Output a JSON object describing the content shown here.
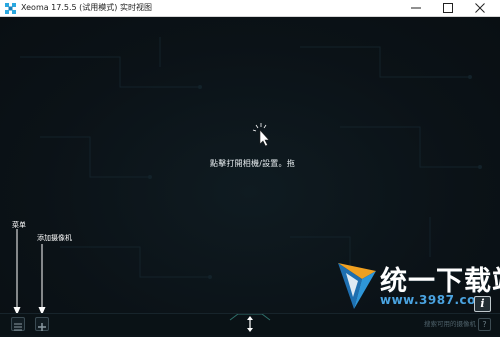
{
  "window": {
    "title": "Xeoma 17.5.5 (试用模式) 实时视图",
    "minimize_icon": "minimize-icon",
    "maximize_icon": "maximize-icon",
    "close_icon": "close-icon"
  },
  "main": {
    "hint": "點擊打開相機/設置。拖",
    "cursor_icon": "click-cursor-icon"
  },
  "annotations": {
    "menu_label": "菜单",
    "add_camera_label": "添加摄像机"
  },
  "bottom_bar": {
    "menu_icon": "list-menu-icon",
    "add_icon": "plus-icon",
    "resize_icon": "vertical-resize-icon",
    "search_placeholder": "搜索可用的摄像机",
    "help_label": "?",
    "info_label": "i"
  },
  "watermark": {
    "title": "统一下载站",
    "url": "www.3987.com"
  },
  "colors": {
    "background": "#0c1419",
    "accent_blue": "#4aa3e0",
    "logo_orange": "#f0a020"
  }
}
